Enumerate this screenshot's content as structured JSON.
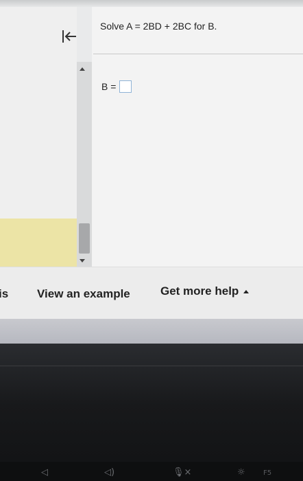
{
  "problem": {
    "text": "Solve A = 2BD + 2BC for B."
  },
  "answer": {
    "label": "B ="
  },
  "footer": {
    "partial_link": "is",
    "view_example": "View an example",
    "get_help": "Get more help"
  },
  "keyboard": {
    "f5_label": "F5"
  },
  "icons": {
    "back": "back-to-start-icon",
    "help_caret": "caret-up-icon"
  }
}
